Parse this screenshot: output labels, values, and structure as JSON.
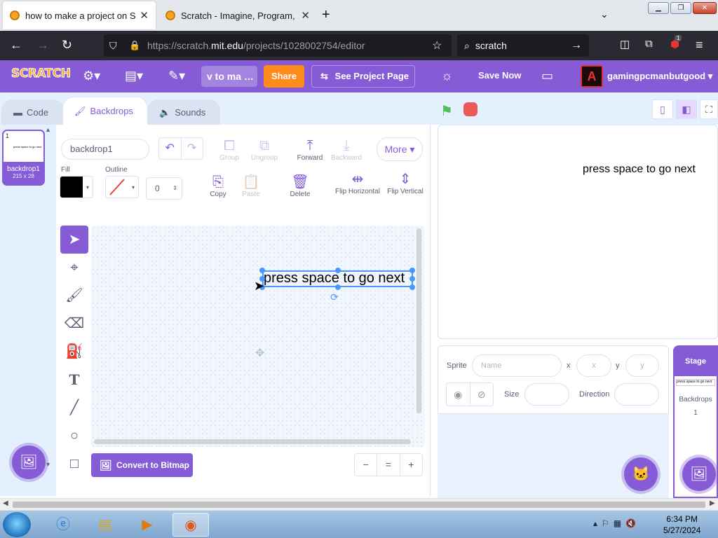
{
  "browser": {
    "tabs": [
      {
        "label": "how to make a project on Scratch",
        "active": true
      },
      {
        "label": "Scratch - Imagine, Program, Share",
        "active": false
      }
    ],
    "url_prefix": "https://scratch.",
    "url_domain": "mit.edu",
    "url_path": "/projects/1028002754/editor",
    "search_text": "scratch",
    "extension_badge": "1"
  },
  "menubar": {
    "logo": "SCRATCH",
    "project_title": "v to ma …",
    "share_label": "Share",
    "see_project_label": "See Project Page",
    "save_now_label": "Save Now",
    "username": "gamingpcmanbutgood",
    "avatar_letter": "A"
  },
  "editor_tabs": {
    "code": "Code",
    "backdrops": "Backdrops",
    "sounds": "Sounds"
  },
  "backdrop_list": {
    "items": [
      {
        "index": "1",
        "name": "backdrop1",
        "size": "215 x 28",
        "thumb_text": "press space to go next"
      }
    ]
  },
  "paint": {
    "name_value": "backdrop1",
    "group_label": "Group",
    "ungroup_label": "Ungroup",
    "forward_label": "Forward",
    "backward_label": "Backward",
    "more_label": "More",
    "fill_label": "Fill",
    "outline_label": "Outline",
    "stroke_width": "0",
    "copy_label": "Copy",
    "paste_label": "Paste",
    "delete_label": "Delete",
    "flip_h_label": "Flip Horizontal",
    "flip_v_label": "Flip Vertical",
    "canvas_text": "press space to go next",
    "convert_label": "Convert to Bitmap",
    "zoom_out": "−",
    "zoom_reset": "=",
    "zoom_in": "+",
    "colors": {
      "fill": "#000000",
      "accent": "#855cd6",
      "selection": "#4c97ff"
    }
  },
  "stage": {
    "text": "press space to go next"
  },
  "sprite_info": {
    "sprite_label": "Sprite",
    "name_placeholder": "Name",
    "x_label": "x",
    "x_placeholder": "x",
    "y_label": "y",
    "y_placeholder": "y",
    "size_label": "Size",
    "direction_label": "Direction"
  },
  "stage_panel": {
    "title": "Stage",
    "thumb_text": "press space to go next",
    "backdrops_label": "Backdrops",
    "backdrops_count": "1"
  },
  "taskbar": {
    "time": "6:34 PM",
    "date": "5/27/2024"
  }
}
